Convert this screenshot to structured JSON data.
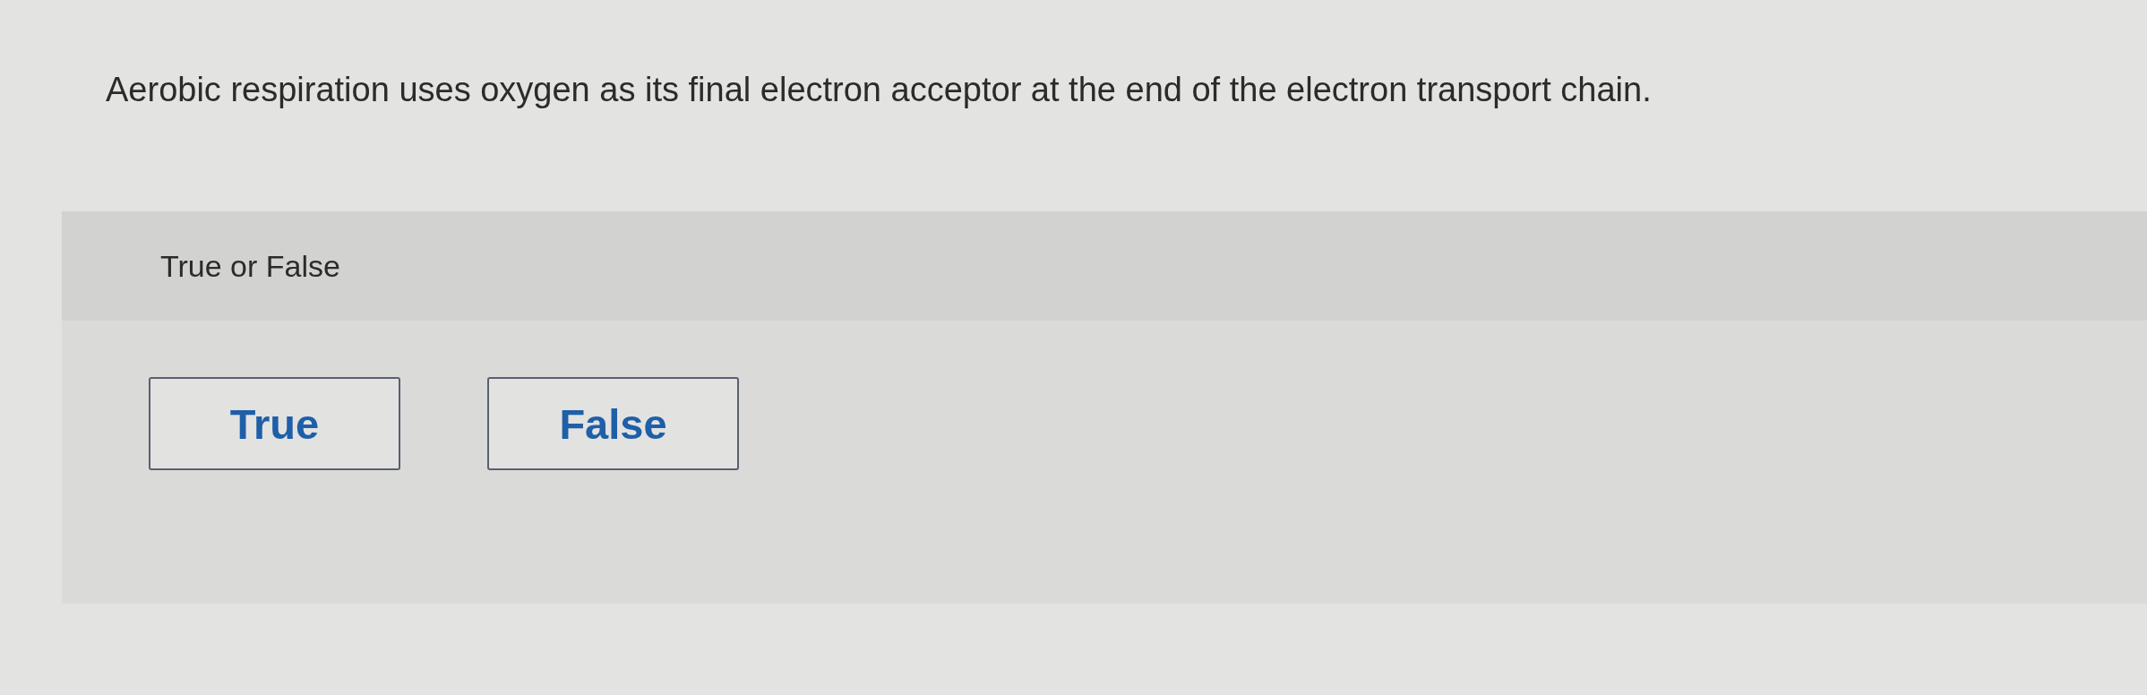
{
  "question": {
    "text": "Aerobic respiration uses oxygen as its final electron acceptor at the end of the electron transport chain."
  },
  "answer_panel": {
    "prompt": "True or False",
    "options": [
      {
        "label": "True",
        "selected": false
      },
      {
        "label": "False",
        "selected": false
      }
    ]
  }
}
